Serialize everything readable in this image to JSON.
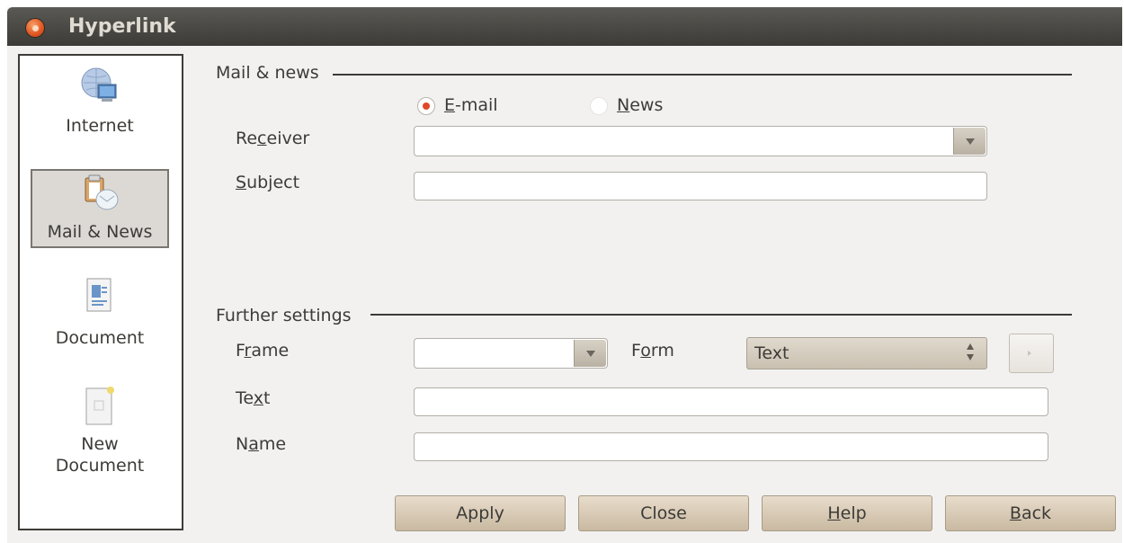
{
  "window": {
    "title": "Hyperlink"
  },
  "sidebar": {
    "items": [
      {
        "label": "Internet"
      },
      {
        "label": "Mail & News"
      },
      {
        "label": "Document"
      },
      {
        "label_line1": "New",
        "label_line2": "Document"
      }
    ],
    "selected": "Mail & News"
  },
  "mail_news": {
    "section_label": "Mail & news",
    "radio_email_prefix": "",
    "radio_email_u": "E",
    "radio_email_rest": "-mail",
    "radio_news_u": "N",
    "radio_news_rest": "ews",
    "selected_type": "E-mail",
    "receiver": {
      "label_a": "Re",
      "label_u": "c",
      "label_b": "eiver",
      "value": ""
    },
    "subject": {
      "label_u": "S",
      "label_b": "ubject",
      "value": ""
    }
  },
  "further": {
    "section_label": "Further settings",
    "frame": {
      "label_a": "F",
      "label_u": "r",
      "label_b": "ame",
      "value": ""
    },
    "form": {
      "label_a": "F",
      "label_u": "o",
      "label_b": "rm",
      "value": "Text"
    },
    "text": {
      "label_a": "Te",
      "label_u": "x",
      "label_b": "t",
      "value": ""
    },
    "name": {
      "label_a": "N",
      "label_u": "a",
      "label_b": "me",
      "value": ""
    }
  },
  "buttons": {
    "apply": "Apply",
    "close": "Close",
    "help_u": "H",
    "help_rest": "elp",
    "back_u": "B",
    "back_rest": "ack"
  },
  "colors": {
    "titlebar": "#3c3b37",
    "radio_selected": "#df4a28",
    "window_bg": "#f2f1f0"
  }
}
